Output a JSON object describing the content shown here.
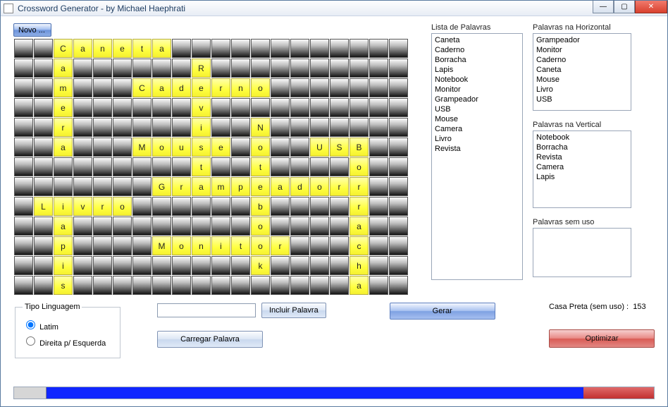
{
  "window": {
    "title": "Crossword Generator - by Michael Haephrati"
  },
  "toolbar": {
    "novo": "Novo ..."
  },
  "grid": {
    "cols": 20,
    "rows": 12,
    "cells": {
      "0": {
        "2": "C",
        "3": "a",
        "4": "n",
        "5": "e",
        "6": "t",
        "7": "a"
      },
      "1": {
        "2": "a",
        "9": "R"
      },
      "2": {
        "2": "m",
        "6": "C",
        "7": "a",
        "8": "d",
        "9": "e",
        "10": "r",
        "11": "n",
        "12": "o"
      },
      "3": {
        "2": "e",
        "9": "v"
      },
      "4": {
        "2": "r",
        "9": "i",
        "12": "N"
      },
      "5": {
        "2": "a",
        "6": "M",
        "7": "o",
        "8": "u",
        "9": "s",
        "10": "e",
        "12": "o",
        "15": "U",
        "16": "S",
        "17": "B"
      },
      "6": {
        "9": "t",
        "12": "t",
        "17": "o"
      },
      "7": {
        "7": "G",
        "8": "r",
        "9": "a",
        "10": "m",
        "11": "p",
        "12": "e",
        "13": "a",
        "14": "d",
        "15": "o",
        "16": "r",
        "17": "r"
      },
      "8": {
        "1": "L",
        "2": "i",
        "3": "v",
        "4": "r",
        "5": "o",
        "12": "b",
        "17": "r"
      },
      "9": {
        "2": "a",
        "12": "o",
        "17": "a"
      },
      "10": {
        "2": "p",
        "7": "M",
        "8": "o",
        "9": "n",
        "10": "i",
        "11": "t",
        "12": "o",
        "13": "r",
        "17": "c"
      },
      "11": {
        "2": "i",
        "12": "k",
        "17": "h"
      },
      "12": {
        "2": "s",
        "17": "a"
      }
    }
  },
  "lists": {
    "palavras_label": "Lista de Palavras",
    "palavras": [
      "Caneta",
      "Caderno",
      "Borracha",
      "Lapis",
      "Notebook",
      "Monitor",
      "Grampeador",
      "USB",
      "Mouse",
      "Camera",
      "Livro",
      "Revista"
    ],
    "horiz_label": "Palavras na Horizontal",
    "horiz": [
      "Grampeador",
      "Monitor",
      "Caderno",
      "Caneta",
      "Mouse",
      "Livro",
      "USB"
    ],
    "vert_label": "Palavras na Vertical",
    "vert": [
      "Notebook",
      "Borracha",
      "Revista",
      "Camera",
      "Lapis"
    ],
    "semuso_label": "Palavras sem uso",
    "semuso": []
  },
  "lang": {
    "legend": "Tipo Linguagem",
    "latim": "Latim",
    "direita": "Direita p/ Esquerda"
  },
  "buttons": {
    "incluir": "Incluir Palavra",
    "carregar": "Carregar Palavra",
    "gerar": "Gerar",
    "optimizar": "Optimizar"
  },
  "status": {
    "casapreta_label": "Casa Preta (sem uso)  :",
    "casapreta_value": "153"
  }
}
